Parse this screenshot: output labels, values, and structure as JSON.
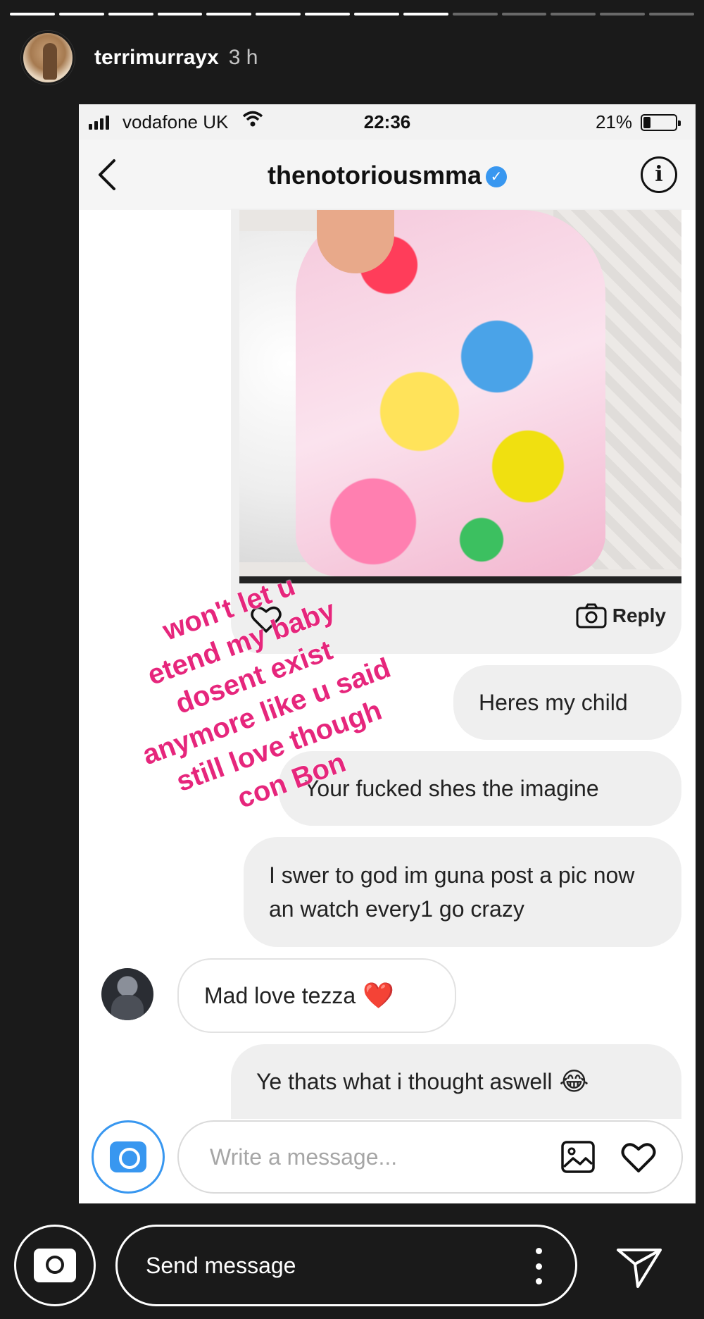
{
  "story": {
    "username": "terrimurrayx",
    "time_ago": "3 h",
    "progress_segments": 14,
    "progress_done": 9
  },
  "screenshot": {
    "status": {
      "carrier": "vodafone UK",
      "time": "22:36",
      "battery": "21%"
    },
    "header": {
      "back_icon": "chevron-left-icon",
      "title": "thenotoriousmma",
      "verified_icon": "verified-badge-icon",
      "info_icon": "info-icon"
    },
    "photo_message": {
      "reply_label": "Reply"
    },
    "messages": [
      {
        "text": "Heres my child",
        "direction": "outgoing"
      },
      {
        "text": "Your fucked shes the imagine",
        "direction": "outgoing"
      },
      {
        "text": "I swer to god im guna post a pic now an watch every1 go crazy",
        "direction": "outgoing"
      },
      {
        "text": "Mad love tezza",
        "emoji": "❤️",
        "direction": "incoming"
      },
      {
        "text": "Ye thats what i thought aswell",
        "emoji": "😂",
        "direction": "outgoing"
      }
    ],
    "composer": {
      "placeholder": "Write a message..."
    },
    "overlay_lines": [
      "won't let u",
      "etend my baby",
      "dosent exist",
      "anymore like u said",
      "still love though",
      "con Bon"
    ]
  },
  "reply_bar": {
    "placeholder": "Send message"
  },
  "colors": {
    "story_bg": "#1a1a1a",
    "ig_blue": "#3897f0",
    "overlay_pink": "#e6267c"
  }
}
